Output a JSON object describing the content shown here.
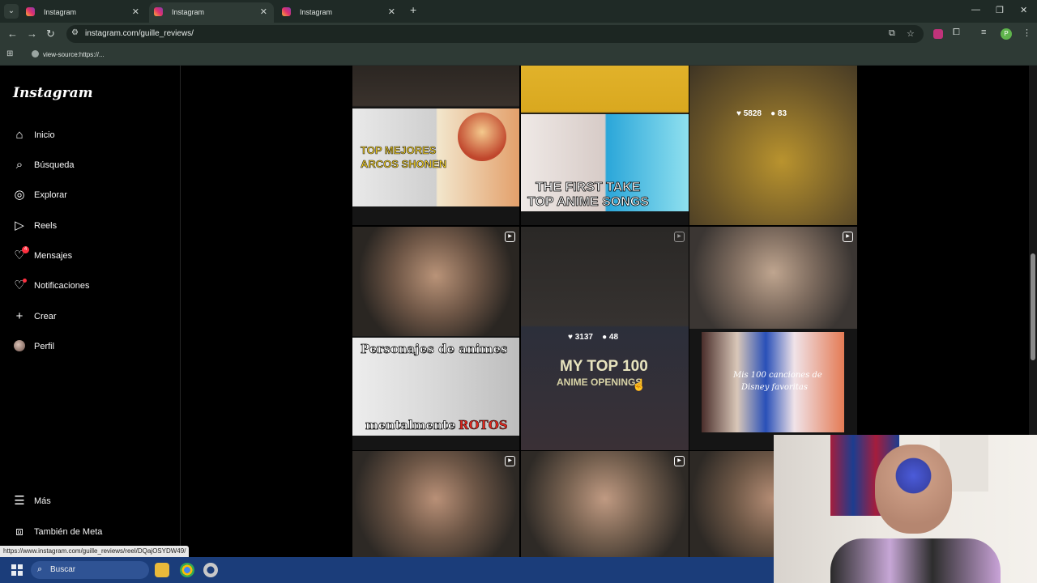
{
  "browser": {
    "tabs": [
      {
        "title": "Instagram",
        "active": false
      },
      {
        "title": "Instagram",
        "active": true
      },
      {
        "title": "Instagram",
        "active": false
      }
    ],
    "new_tab": "+",
    "url": "instagram.com/guille_reviews/",
    "bookmark": "view-source:https://...",
    "profile_initial": "P",
    "window_controls": {
      "minimize": "—",
      "restore": "❐",
      "close": "✕"
    }
  },
  "sidebar": {
    "logo": "Instagram",
    "items": [
      {
        "label": "Inicio",
        "icon": "home-icon"
      },
      {
        "label": "Búsqueda",
        "icon": "search-icon"
      },
      {
        "label": "Explorar",
        "icon": "compass-icon"
      },
      {
        "label": "Reels",
        "icon": "reels-icon"
      },
      {
        "label": "Mensajes",
        "icon": "messenger-icon",
        "badge": "4"
      },
      {
        "label": "Notificaciones",
        "icon": "heart-icon"
      },
      {
        "label": "Crear",
        "icon": "plus-icon"
      },
      {
        "label": "Perfil",
        "icon": "avatar-icon"
      }
    ],
    "bottom": [
      {
        "label": "Más",
        "icon": "menu-icon"
      },
      {
        "label": "También de Meta",
        "icon": "meta-icon"
      }
    ]
  },
  "grid": {
    "stats_top_right": {
      "likes": "5828",
      "comments": "83"
    },
    "stats_center": {
      "likes": "3137",
      "comments": "48"
    },
    "thumb_texts": {
      "shonen_1": "TOP MEJORES",
      "shonen_2": "ARCOS SHONEN",
      "firsttake_1": "THE FIRST TAKE",
      "firsttake_2": "TOP ANIME SONGS",
      "personajes_1": "Personajes de animes",
      "personajes_2": "mentalmente",
      "personajes_3": "ROTOS",
      "top100_1": "MY TOP 100",
      "top100_2": "ANIME OPENINGS",
      "disney_1": "Mis 100 canciones de",
      "disney_2": "Disney favoritas"
    }
  },
  "status_url": "https://www.instagram.com/guille_reviews/reel/DQajOSYDW49/",
  "taskbar": {
    "search_placeholder": "Buscar"
  },
  "colors": {
    "notification": "#ff3040",
    "taskbar": "#1b3d7a",
    "chrome": "#2e3a35"
  }
}
